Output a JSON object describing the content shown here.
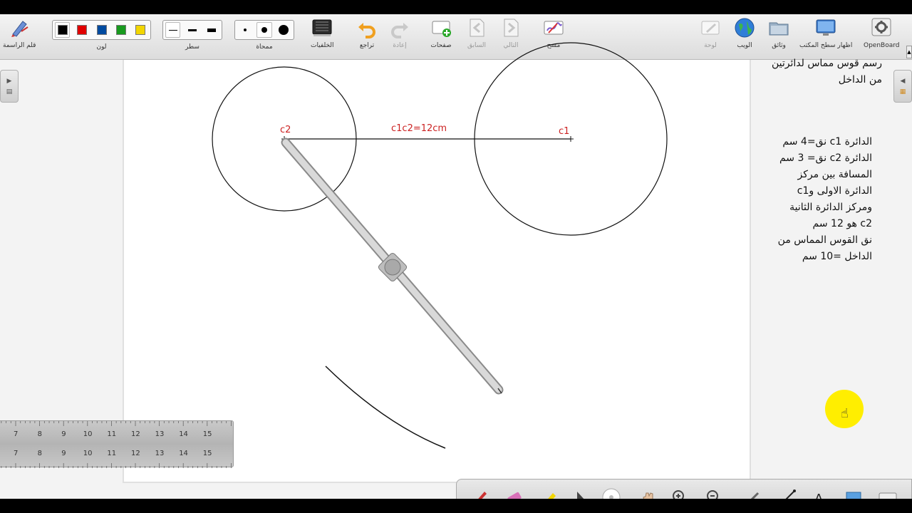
{
  "toolbar": {
    "pen_label": "قلم الراسمة",
    "color_label": "لون",
    "colors": [
      "#000000",
      "#e00000",
      "#004a9f",
      "#189a1e",
      "#f2d600"
    ],
    "line_label": "سطر",
    "eraser_label": "ممحاة",
    "backgrounds_label": "الخلفيات",
    "undo_label": "تراجع",
    "redo_label": "إعادة",
    "pages_label": "صفحات",
    "previous_label": "السابق",
    "next_label": "التالي",
    "clear_label": "مسح",
    "board_label": "لوحة",
    "web_label": "الويب",
    "documents_label": "وثائق",
    "desktop_label": "اظهار سطح المكتب",
    "app_label": "OpenBoard"
  },
  "board": {
    "c1_label": "c1",
    "c2_label": "c2",
    "distance_label": "c1c2=12cm"
  },
  "notes": {
    "title_line1": "رسم قوس مماس لدائرتين",
    "title_line2": "من الداخل",
    "lines": [
      "الدائرة c1 نق=4 سم",
      "الدائرة c2 نق= 3 سم",
      "المسافة بين مركز",
      "الدائرة الاولى وc1",
      "ومركز الدائرة الثانية",
      "c2  هو 12 سم",
      "نق القوس المماس من",
      "الداخل =10 سم"
    ]
  },
  "ruler": {
    "numbers": [
      "7",
      "8",
      "9",
      "10",
      "11",
      "12",
      "13",
      "14",
      "15"
    ]
  },
  "accent_color": "#cc2222"
}
